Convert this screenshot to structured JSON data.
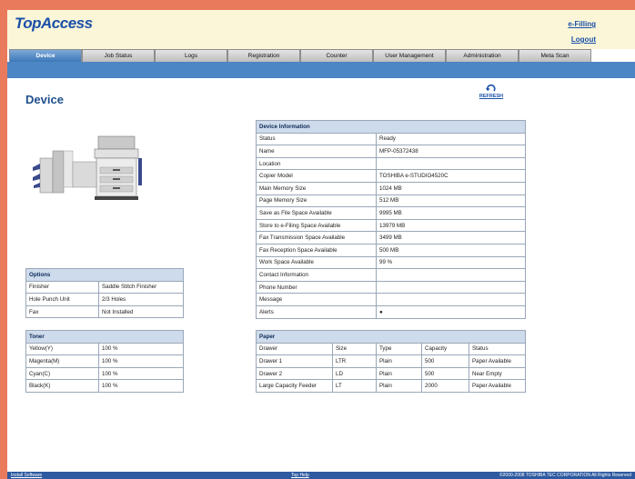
{
  "app": {
    "logo": "TopAccess",
    "efiling_link": "e-Filling",
    "logout_link": "Logout"
  },
  "tabs": [
    {
      "label": "Device",
      "active": true
    },
    {
      "label": "Job Status",
      "active": false
    },
    {
      "label": "Logs",
      "active": false
    },
    {
      "label": "Registration",
      "active": false
    },
    {
      "label": "Counter",
      "active": false
    },
    {
      "label": "User Management",
      "active": false
    },
    {
      "label": "Administration",
      "active": false
    },
    {
      "label": "Meta Scan",
      "active": false
    }
  ],
  "page": {
    "title": "Device",
    "refresh_label": "REFRESH"
  },
  "device_info": {
    "caption": "Device Information",
    "rows": [
      {
        "label": "Status",
        "value": "Ready"
      },
      {
        "label": "Name",
        "value": "MFP-05372438"
      },
      {
        "label": "Location",
        "value": ""
      },
      {
        "label": "Copier Model",
        "value": "TOSHIBA e-STUDIO4520C"
      },
      {
        "label": "Main Memory Size",
        "value": "1024 MB"
      },
      {
        "label": "Page Memory Size",
        "value": "512 MB"
      },
      {
        "label": "Save as File Space Available",
        "value": "9995 MB"
      },
      {
        "label": "Store to e-Filing Space Available",
        "value": "13979 MB"
      },
      {
        "label": "Fax Transmission Space Available",
        "value": "3499 MB"
      },
      {
        "label": "Fax Reception Space Available",
        "value": "500 MB"
      },
      {
        "label": "Work Space Available",
        "value": "99 %"
      },
      {
        "label": "Contact Information",
        "value": ""
      },
      {
        "label": "Phone Number",
        "value": ""
      },
      {
        "label": "Message",
        "value": ""
      },
      {
        "label": "Alerts",
        "value": "●"
      }
    ]
  },
  "options": {
    "caption": "Options",
    "rows": [
      {
        "label": "Finisher",
        "value": "Saddle Stitch Finisher"
      },
      {
        "label": "Hole Punch Unit",
        "value": "2/3 Holes"
      },
      {
        "label": "Fax",
        "value": "Not Installed"
      }
    ]
  },
  "toner": {
    "caption": "Toner",
    "rows": [
      {
        "label": "Yellow(Y)",
        "value": "100 %"
      },
      {
        "label": "Magenta(M)",
        "value": "100 %"
      },
      {
        "label": "Cyan(C)",
        "value": "100 %"
      },
      {
        "label": "Black(K)",
        "value": "100 %"
      }
    ]
  },
  "paper": {
    "caption": "Paper",
    "headers": [
      "Drawer",
      "Size",
      "Type",
      "Capacity",
      "Status"
    ],
    "rows": [
      [
        "Drawer 1",
        "LTR",
        "Plain",
        "500",
        "Paper Available"
      ],
      [
        "Drawer 2",
        "LD",
        "Plain",
        "500",
        "Near Empty"
      ],
      [
        "Large Capacity Feeder",
        "LT",
        "Plain",
        "2000",
        "Paper Available"
      ]
    ]
  },
  "footer": {
    "left": "Install Software",
    "center": "Top   Help",
    "right": "©2000-2008 TOSHIBA TEC CORPORATION All Rights Reserved"
  },
  "colors": {
    "accent": "#1a4fa8",
    "header_bg": "#fbf6d8",
    "tab_active": "#3d78b8",
    "table_header": "#cddbec",
    "outer_frame": "#e97b5c"
  },
  "icons": {
    "refresh": "refresh-icon",
    "printer": "printer-device-image"
  }
}
